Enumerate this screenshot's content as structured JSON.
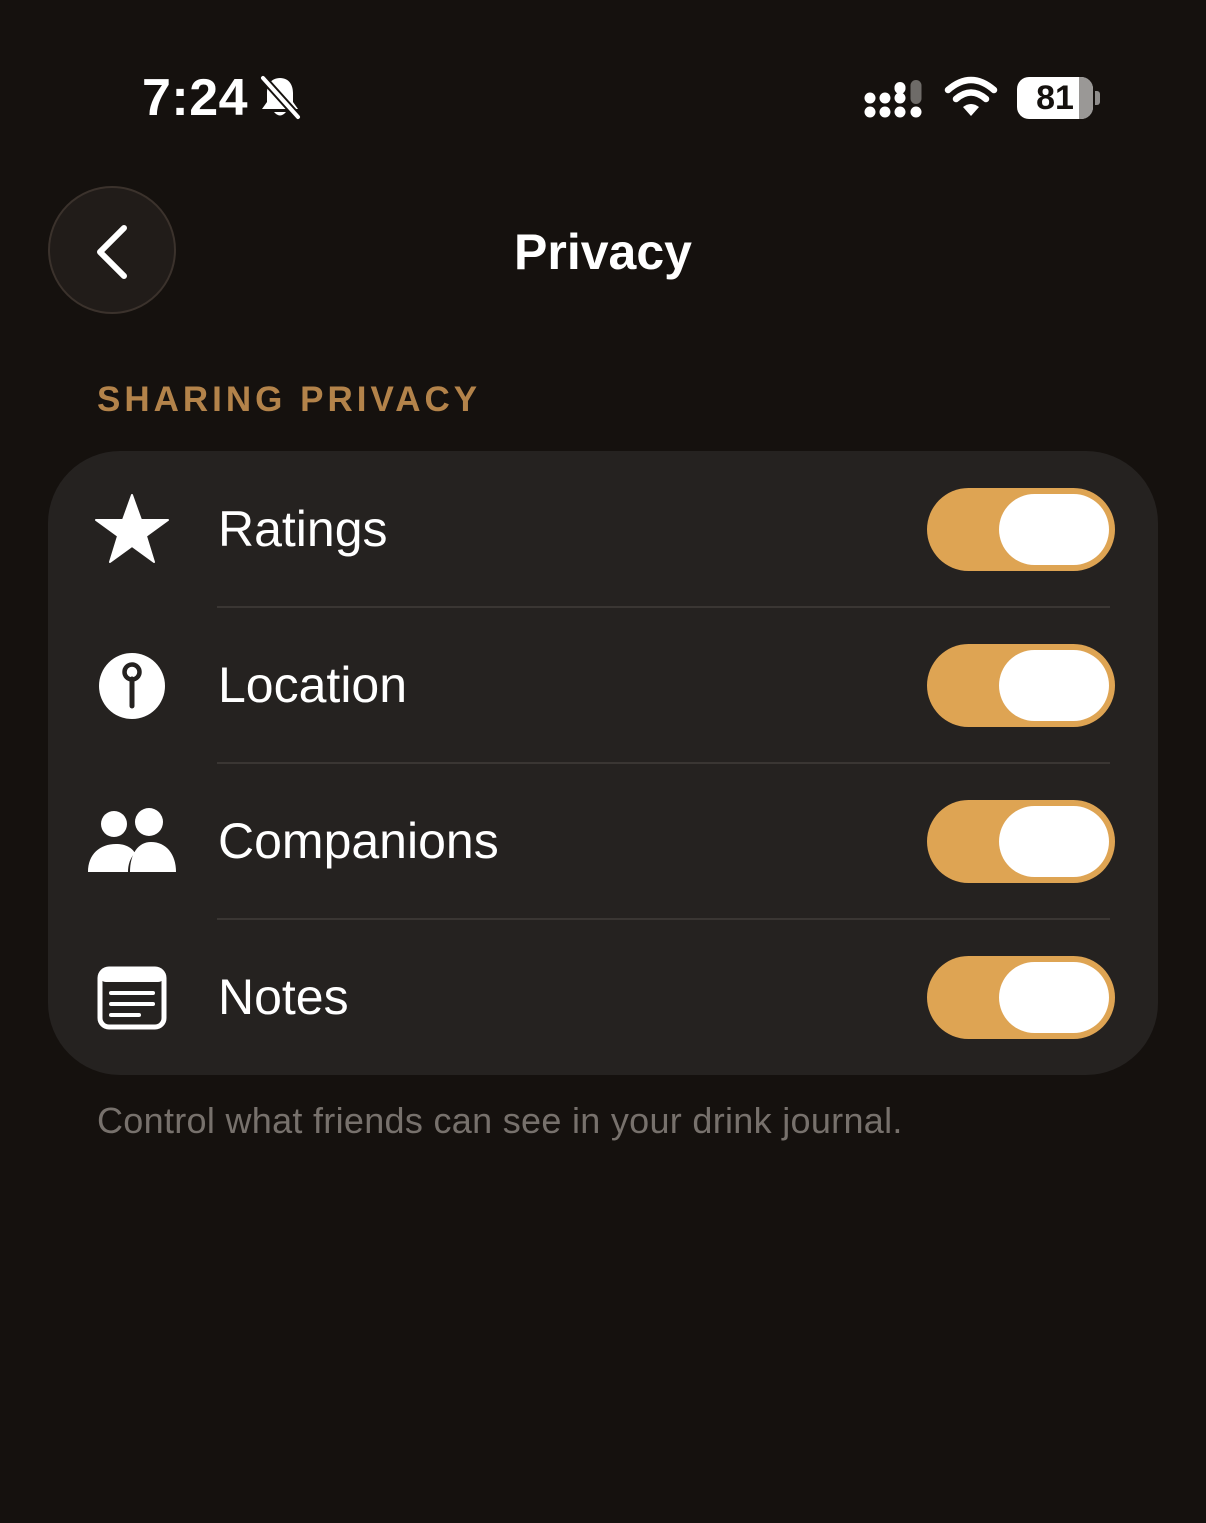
{
  "status_bar": {
    "time": "7:24",
    "battery_level": "81",
    "battery_fraction": 0.81,
    "icons": [
      "bell-off-icon",
      "cellular-signal-icon",
      "wifi-icon",
      "battery-icon"
    ]
  },
  "header": {
    "title": "Privacy",
    "back_icon": "chevron-left-icon"
  },
  "section": {
    "title": "SHARING PRIVACY",
    "footer": "Control what friends can see in your drink journal.",
    "items": [
      {
        "label": "Ratings",
        "icon": "star-icon",
        "enabled": true
      },
      {
        "label": "Location",
        "icon": "location-pin-icon",
        "enabled": true
      },
      {
        "label": "Companions",
        "icon": "people-icon",
        "enabled": true
      },
      {
        "label": "Notes",
        "icon": "notes-icon",
        "enabled": true
      }
    ]
  },
  "colors": {
    "background": "#15110e",
    "card": "#252220",
    "accent": "#dea453",
    "section_header": "#b3834a",
    "footer_text": "#77716c"
  }
}
